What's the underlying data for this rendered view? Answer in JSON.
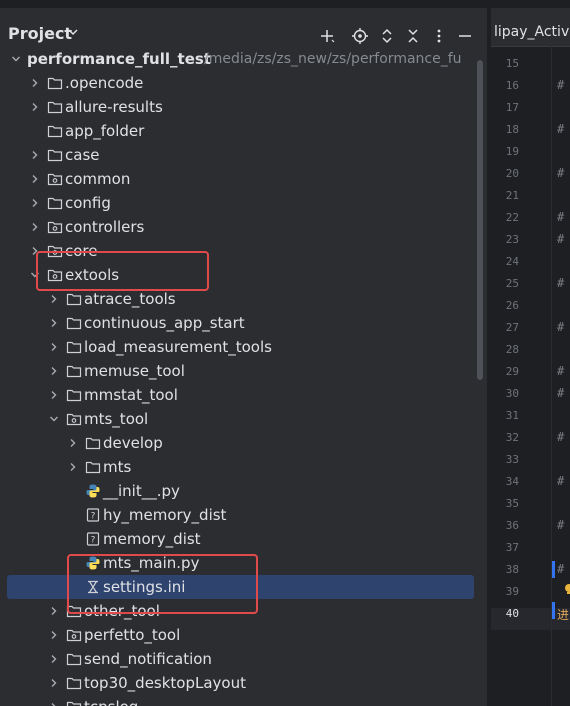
{
  "panel": {
    "title": "Project",
    "toolbar": [
      "add-icon",
      "locate-icon",
      "expand-all-icon",
      "collapse-all-icon",
      "more-options-icon",
      "minimize-icon"
    ]
  },
  "tree": [
    {
      "label": "performance_full_test",
      "path": "/media/zs/zs_new/zs/performance_fu",
      "indent": 0,
      "chevron": "down",
      "icon": "none",
      "bold": true
    },
    {
      "label": ".opencode",
      "indent": 1,
      "chevron": "right",
      "icon": "folder"
    },
    {
      "label": "allure-results",
      "indent": 1,
      "chevron": "right",
      "icon": "folder"
    },
    {
      "label": "app_folder",
      "indent": 1,
      "chevron": "none",
      "icon": "folder"
    },
    {
      "label": "case",
      "indent": 1,
      "chevron": "right",
      "icon": "folder"
    },
    {
      "label": "common",
      "indent": 1,
      "chevron": "right",
      "icon": "package"
    },
    {
      "label": "config",
      "indent": 1,
      "chevron": "right",
      "icon": "folder"
    },
    {
      "label": "controllers",
      "indent": 1,
      "chevron": "right",
      "icon": "package"
    },
    {
      "label": "core",
      "indent": 1,
      "chevron": "right",
      "icon": "package"
    },
    {
      "label": "extools",
      "indent": 1,
      "chevron": "down",
      "icon": "package"
    },
    {
      "label": "atrace_tools",
      "indent": 2,
      "chevron": "right",
      "icon": "folder"
    },
    {
      "label": "continuous_app_start",
      "indent": 2,
      "chevron": "right",
      "icon": "folder"
    },
    {
      "label": "load_measurement_tools",
      "indent": 2,
      "chevron": "right",
      "icon": "folder"
    },
    {
      "label": "memuse_tool",
      "indent": 2,
      "chevron": "right",
      "icon": "folder"
    },
    {
      "label": "mmstat_tool",
      "indent": 2,
      "chevron": "right",
      "icon": "folder"
    },
    {
      "label": "mts_tool",
      "indent": 2,
      "chevron": "down",
      "icon": "package"
    },
    {
      "label": "develop",
      "indent": 3,
      "chevron": "right",
      "icon": "folder"
    },
    {
      "label": "mts",
      "indent": 3,
      "chevron": "right",
      "icon": "folder"
    },
    {
      "label": "__init__.py",
      "indent": 3,
      "chevron": "none",
      "icon": "python"
    },
    {
      "label": "hy_memory_dist",
      "indent": 3,
      "chevron": "none",
      "icon": "unknown"
    },
    {
      "label": "memory_dist",
      "indent": 3,
      "chevron": "none",
      "icon": "unknown"
    },
    {
      "label": "mts_main.py",
      "indent": 3,
      "chevron": "none",
      "icon": "python"
    },
    {
      "label": "settings.ini",
      "indent": 3,
      "chevron": "none",
      "icon": "settings",
      "selected": true
    },
    {
      "label": "other_tool",
      "indent": 2,
      "chevron": "right",
      "icon": "folder"
    },
    {
      "label": "perfetto_tool",
      "indent": 2,
      "chevron": "right",
      "icon": "package"
    },
    {
      "label": "send_notification",
      "indent": 2,
      "chevron": "right",
      "icon": "folder"
    },
    {
      "label": "top30_desktopLayout",
      "indent": 2,
      "chevron": "right",
      "icon": "folder"
    },
    {
      "label": "tcpslog",
      "indent": 2,
      "chevron": "right",
      "icon": "folder"
    }
  ],
  "editor": {
    "tab_label": "lipay_Activ",
    "line_numbers": [
      "15",
      "16",
      "17",
      "18",
      "19",
      "20",
      "21",
      "22",
      "23",
      "24",
      "25",
      "26",
      "27",
      "28",
      "29",
      "30",
      "31",
      "32",
      "33",
      "34",
      "35",
      "36",
      "37",
      "38",
      "39",
      "40"
    ],
    "current_line": "40",
    "code_fragments": [
      {
        "line": "16",
        "text": "#"
      },
      {
        "line": "18",
        "text": "#"
      },
      {
        "line": "20",
        "text": "#"
      },
      {
        "line": "22",
        "text": "#"
      },
      {
        "line": "23",
        "text": "#"
      },
      {
        "line": "25",
        "text": "#"
      },
      {
        "line": "27",
        "text": "#"
      },
      {
        "line": "29",
        "text": "#"
      },
      {
        "line": "30",
        "text": "#"
      },
      {
        "line": "32",
        "text": "#"
      },
      {
        "line": "34",
        "text": "#"
      },
      {
        "line": "36",
        "text": "#"
      },
      {
        "line": "38",
        "text": "#"
      },
      {
        "line": "40",
        "text": "进"
      }
    ]
  },
  "colors": {
    "panel_bg": "#2b2d30",
    "editor_bg": "#1e1f22",
    "selection": "#2e436e",
    "highlight_box": "#e04a4a",
    "text": "#dfe1e5",
    "muted": "#868a91",
    "python_blue": "#4584b6",
    "python_yellow": "#ffde57"
  }
}
